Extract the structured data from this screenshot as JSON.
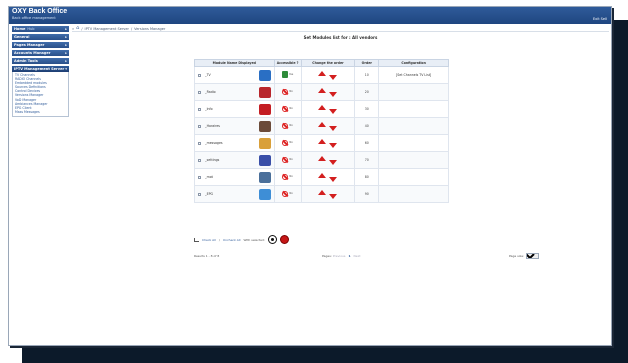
{
  "header": {
    "title": "OXY Back Office",
    "subtitle": "Back office management",
    "logout": "Exit Sell"
  },
  "breadcrumb": {
    "items": [
      "IPTV Management Server",
      "Versions Manager"
    ]
  },
  "sidebar": {
    "sections": [
      {
        "label": "Home",
        "sub": "Hub",
        "open": false
      },
      {
        "label": "General",
        "open": false
      },
      {
        "label": "Pages Manager",
        "open": false
      },
      {
        "label": "Accounts Manager",
        "open": false
      },
      {
        "label": "Admin Tools",
        "open": false
      },
      {
        "label": "IPTV Management Server",
        "open": true
      }
    ],
    "submenu": [
      "TV Channels",
      "RADIO Channels",
      "Embedded modules",
      "Sources Definitions",
      "Control Devices",
      "Versions Manager",
      "VoD Manager",
      "Ambiances Manager",
      "EPG Client",
      "Mass Messages"
    ]
  },
  "page": {
    "title": "Set Modules list for : All vendors"
  },
  "table": {
    "headers": [
      "Module Name Displayed",
      "Accessible ?",
      "Change the order",
      "Order",
      "Configuration"
    ],
    "rows": [
      {
        "name": "_TV",
        "icon": "tv-icon",
        "icon_color": "#2a6fc4",
        "accessible": "Yes",
        "order": "10",
        "config": "[Set Channels TV List]"
      },
      {
        "name": "_Radio",
        "icon": "radio-icon",
        "icon_color": "#b8262c",
        "accessible": "No",
        "order": "20",
        "config": ""
      },
      {
        "name": "_Info",
        "icon": "info-icon",
        "icon_color": "#c41e24",
        "accessible": "No",
        "order": "30",
        "config": ""
      },
      {
        "name": "_Horaires",
        "icon": "clock-icon",
        "icon_color": "#6b4b3a",
        "accessible": "No",
        "order": "40",
        "config": ""
      },
      {
        "name": "_messages",
        "icon": "mail-icon",
        "icon_color": "#d9a03a",
        "accessible": "No",
        "order": "60",
        "config": ""
      },
      {
        "name": "_settings",
        "icon": "settings-icon",
        "icon_color": "#3a4fa8",
        "accessible": "No",
        "order": "70",
        "config": ""
      },
      {
        "name": "_mot",
        "icon": "weather-icon",
        "icon_color": "#4a6f9a",
        "accessible": "No",
        "order": "80",
        "config": ""
      },
      {
        "name": "_EPG",
        "icon": "epg-icon",
        "icon_color": "#3e8ed6",
        "accessible": "No",
        "order": "90",
        "config": ""
      }
    ]
  },
  "actions": {
    "check_all": "Check All",
    "uncheck_all": "Uncheck All",
    "with_selected": "With selected:"
  },
  "pager": {
    "results": "Results 1 - 8 of 8",
    "pages_label": "Pages:",
    "prev": "Previous",
    "current": "1",
    "next": "Next",
    "per_page_label": "Page size:",
    "per_page_value": "20"
  }
}
